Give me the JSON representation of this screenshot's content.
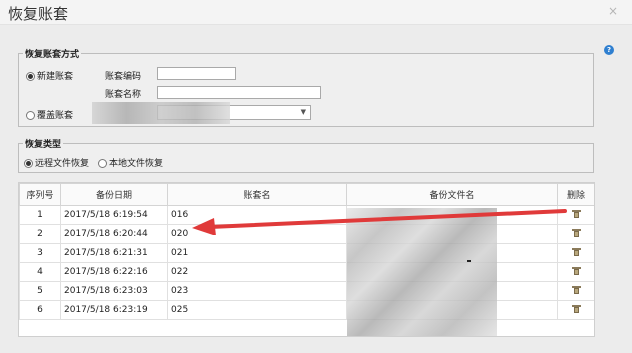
{
  "window": {
    "title": "恢复账套",
    "close_label": "×"
  },
  "help_label": "?",
  "restore_mode": {
    "legend": "恢复账套方式",
    "options": [
      {
        "label": "新建账套",
        "selected": true
      },
      {
        "label": "覆盖账套",
        "selected": false
      }
    ],
    "fields": {
      "code_label": "账套编码",
      "name_label": "账套名称",
      "code_value": "",
      "name_value": ""
    },
    "select_value": ""
  },
  "restore_type": {
    "legend": "恢复类型",
    "options": [
      {
        "label": "远程文件恢复",
        "selected": true
      },
      {
        "label": "本地文件恢复",
        "selected": false
      }
    ]
  },
  "table": {
    "headers": [
      "序列号",
      "备份日期",
      "账套名",
      "备份文件名",
      "删除"
    ],
    "rows": [
      {
        "seq": "1",
        "date": "2017/5/18 6:19:54",
        "name": "016"
      },
      {
        "seq": "2",
        "date": "2017/5/18 6:20:44",
        "name": "020"
      },
      {
        "seq": "3",
        "date": "2017/5/18 6:21:31",
        "name": "021"
      },
      {
        "seq": "4",
        "date": "2017/5/18 6:22:16",
        "name": "022"
      },
      {
        "seq": "5",
        "date": "2017/5/18 6:23:03",
        "name": "023"
      },
      {
        "seq": "6",
        "date": "2017/5/18 6:23:19",
        "name": "025"
      }
    ]
  },
  "colors": {
    "arrow": "#e03a3a",
    "help": "#2f7fd0"
  },
  "icons": {
    "delete": "trash-icon",
    "close": "close-icon",
    "help": "help-icon",
    "dropdown": "chevron-down-icon"
  }
}
